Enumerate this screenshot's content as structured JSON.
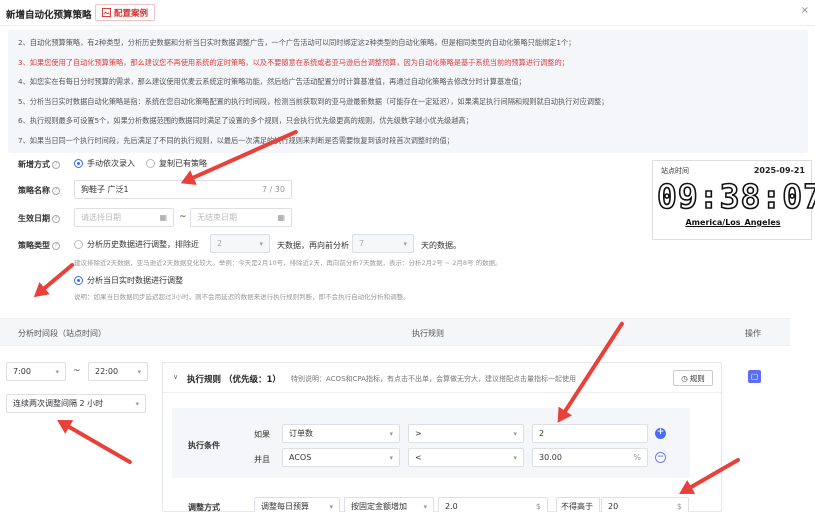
{
  "header": {
    "title": "新增自动化预算策略",
    "case_button": "配置案例",
    "close_glyph": "×"
  },
  "notes": [
    {
      "text": "2、自动化预算策略，有2种类型，分析历史数据和分析当日实时数据调整广告，一个广告活动可以同时绑定这2种类型的自动化策略，但是相同类型的自动化策略只能绑定1个；",
      "red": false
    },
    {
      "text": "3、如果您使用了自动化预算策略，那么建议您不再使用系统的定时策略，以及不要随意在系统或者亚马逊后台调整预算，因为自动化策略是基于系统当前的预算进行调整的；",
      "red": true
    },
    {
      "text": "4、如您实在有每日分时预算的需求，那么建议使用优麦云系统定时策略功能，然后给广告活动配置分时计算基准值，再通过自动化策略去修改分时计算基准值；",
      "red": false
    },
    {
      "text": "5、分析当日实时数据自动化策略是指：系统在您自动化策略配置的执行时间段，检测当前获取到的亚马逊最新数据（可能存在一定延迟），如果满足执行间隔和规则就自动执行对应调整；",
      "red": false
    },
    {
      "text": "6、执行规则最多可设置5个，如果分析数据范围的数据同时满足了设置的多个规则，只会执行优先级更高的规则，优先级数字越小优先级越高；",
      "red": false
    },
    {
      "text": "7、如果当日同一个执行时间段，先后满足了不同的执行规则，以最后一次满足的执行规则来判断是否需要恢复到该时段首次调整时的值；",
      "red": false
    }
  ],
  "form": {
    "mode_label": "新增方式",
    "mode_options": [
      "手动依次录入",
      "复制已有策略"
    ],
    "name_label": "策略名称",
    "name_value": "狗鞋子 广泛1",
    "name_count": "7 / 30",
    "date_label": "生效日期",
    "date_start_placeholder": "请选择日期",
    "date_tilde": "~",
    "date_end_placeholder": "无结束日期",
    "type_label": "策略类型",
    "type_history": "分析历史数据进行调整，排除近",
    "exclude_days": "2",
    "days_text_1": "天数据，再向前分析",
    "analyze_days": "7",
    "days_text_2": "天的数据。",
    "history_hint": "建议排除近2天数据，亚马逊近2天数据变化较大。举例：今天是2月10号，排除近2天，再向前分析7天数据，表示：分析2月2号 ~ 2月8号 的数据。",
    "type_realtime": "分析当日实时数据进行调整",
    "realtime_hint": "说明：如果当日数据同步延迟超过3小时，则不会用延迟的数据来进行执行规则判断，即不会执行自动化分析和调整。"
  },
  "clock": {
    "label": "站点时间",
    "date": "2025-09-21",
    "time": "09:38:07",
    "timezone": "America/Los_Angeles"
  },
  "table": {
    "col_period": "分析时间段（站点时间）",
    "col_rule": "执行规则",
    "col_op": "操作",
    "start_time": "7:00",
    "tilde": "~",
    "end_time": "22:00",
    "interval": "连续两次调整间隔 2 小时"
  },
  "rule": {
    "title": "执行规则 （优先级：1）",
    "desc": "特别说明：ACOS和CPA指标，有点击不出单，会算做无穷大，建议搭配点击量指标一起使用",
    "rule_button": "规则",
    "cond_label": "执行条件",
    "if_label": "如果",
    "and_label": "并且",
    "metric1": "订单数",
    "op1": ">",
    "value1": "2",
    "metric2": "ACOS",
    "op2": "<",
    "value2": "30.00",
    "unit2": "%",
    "adjust_label": "调整方式",
    "adjust_type": "调整每日预算",
    "adjust_method": "按固定金额增加",
    "adjust_value": "2.0",
    "adjust_unit": "$",
    "limit_label": "不得高于",
    "limit_value": "20",
    "limit_unit": "$"
  },
  "colors": {
    "accent": "#3a6cf4",
    "warning_text": "#e23b3b",
    "annotation_arrow": "#e8403a"
  }
}
